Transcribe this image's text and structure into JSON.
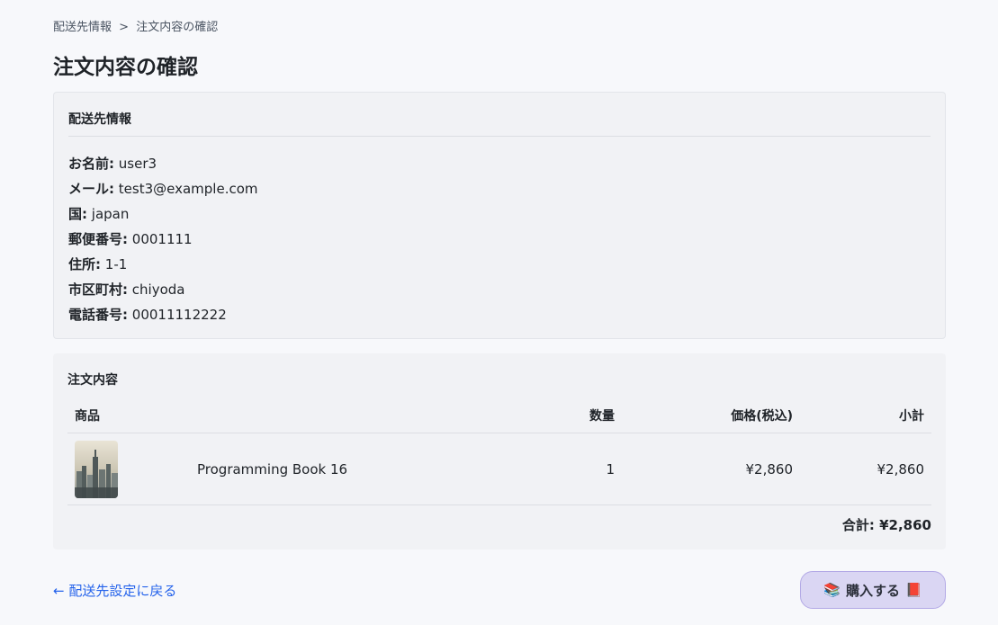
{
  "breadcrumb": {
    "step1": "配送先情報",
    "separator": ">",
    "step2": "注文内容の確認"
  },
  "page_title": "注文内容の確認",
  "shipping": {
    "heading": "配送先情報",
    "fields": [
      {
        "key": "お名前:",
        "value": "user3"
      },
      {
        "key": "メール:",
        "value": "test3@example.com"
      },
      {
        "key": "国:",
        "value": "japan"
      },
      {
        "key": "郵便番号:",
        "value": "0001111"
      },
      {
        "key": "住所:",
        "value": "1-1"
      },
      {
        "key": "市区町村:",
        "value": "chiyoda"
      },
      {
        "key": "電話番号:",
        "value": "00011112222"
      }
    ]
  },
  "order": {
    "heading": "注文内容",
    "columns": {
      "product": "商品",
      "quantity": "数量",
      "price": "価格(税込)",
      "subtotal": "小計"
    },
    "items": [
      {
        "thumbnail": "city-skyline-image",
        "name": "Programming Book 16",
        "quantity": "1",
        "price": "¥2,860",
        "subtotal": "¥2,860"
      }
    ],
    "total": "合計: ¥2,860"
  },
  "actions": {
    "back_arrow": "←",
    "back_label": "配送先設定に戻る",
    "buy_label": "購入する",
    "buy_icon_left": "📚",
    "buy_icon_right": "📕"
  },
  "colors": {
    "link": "#2563eb",
    "buy_button_bg": "#dad6f3",
    "card_bg": "#f1f2f5"
  }
}
